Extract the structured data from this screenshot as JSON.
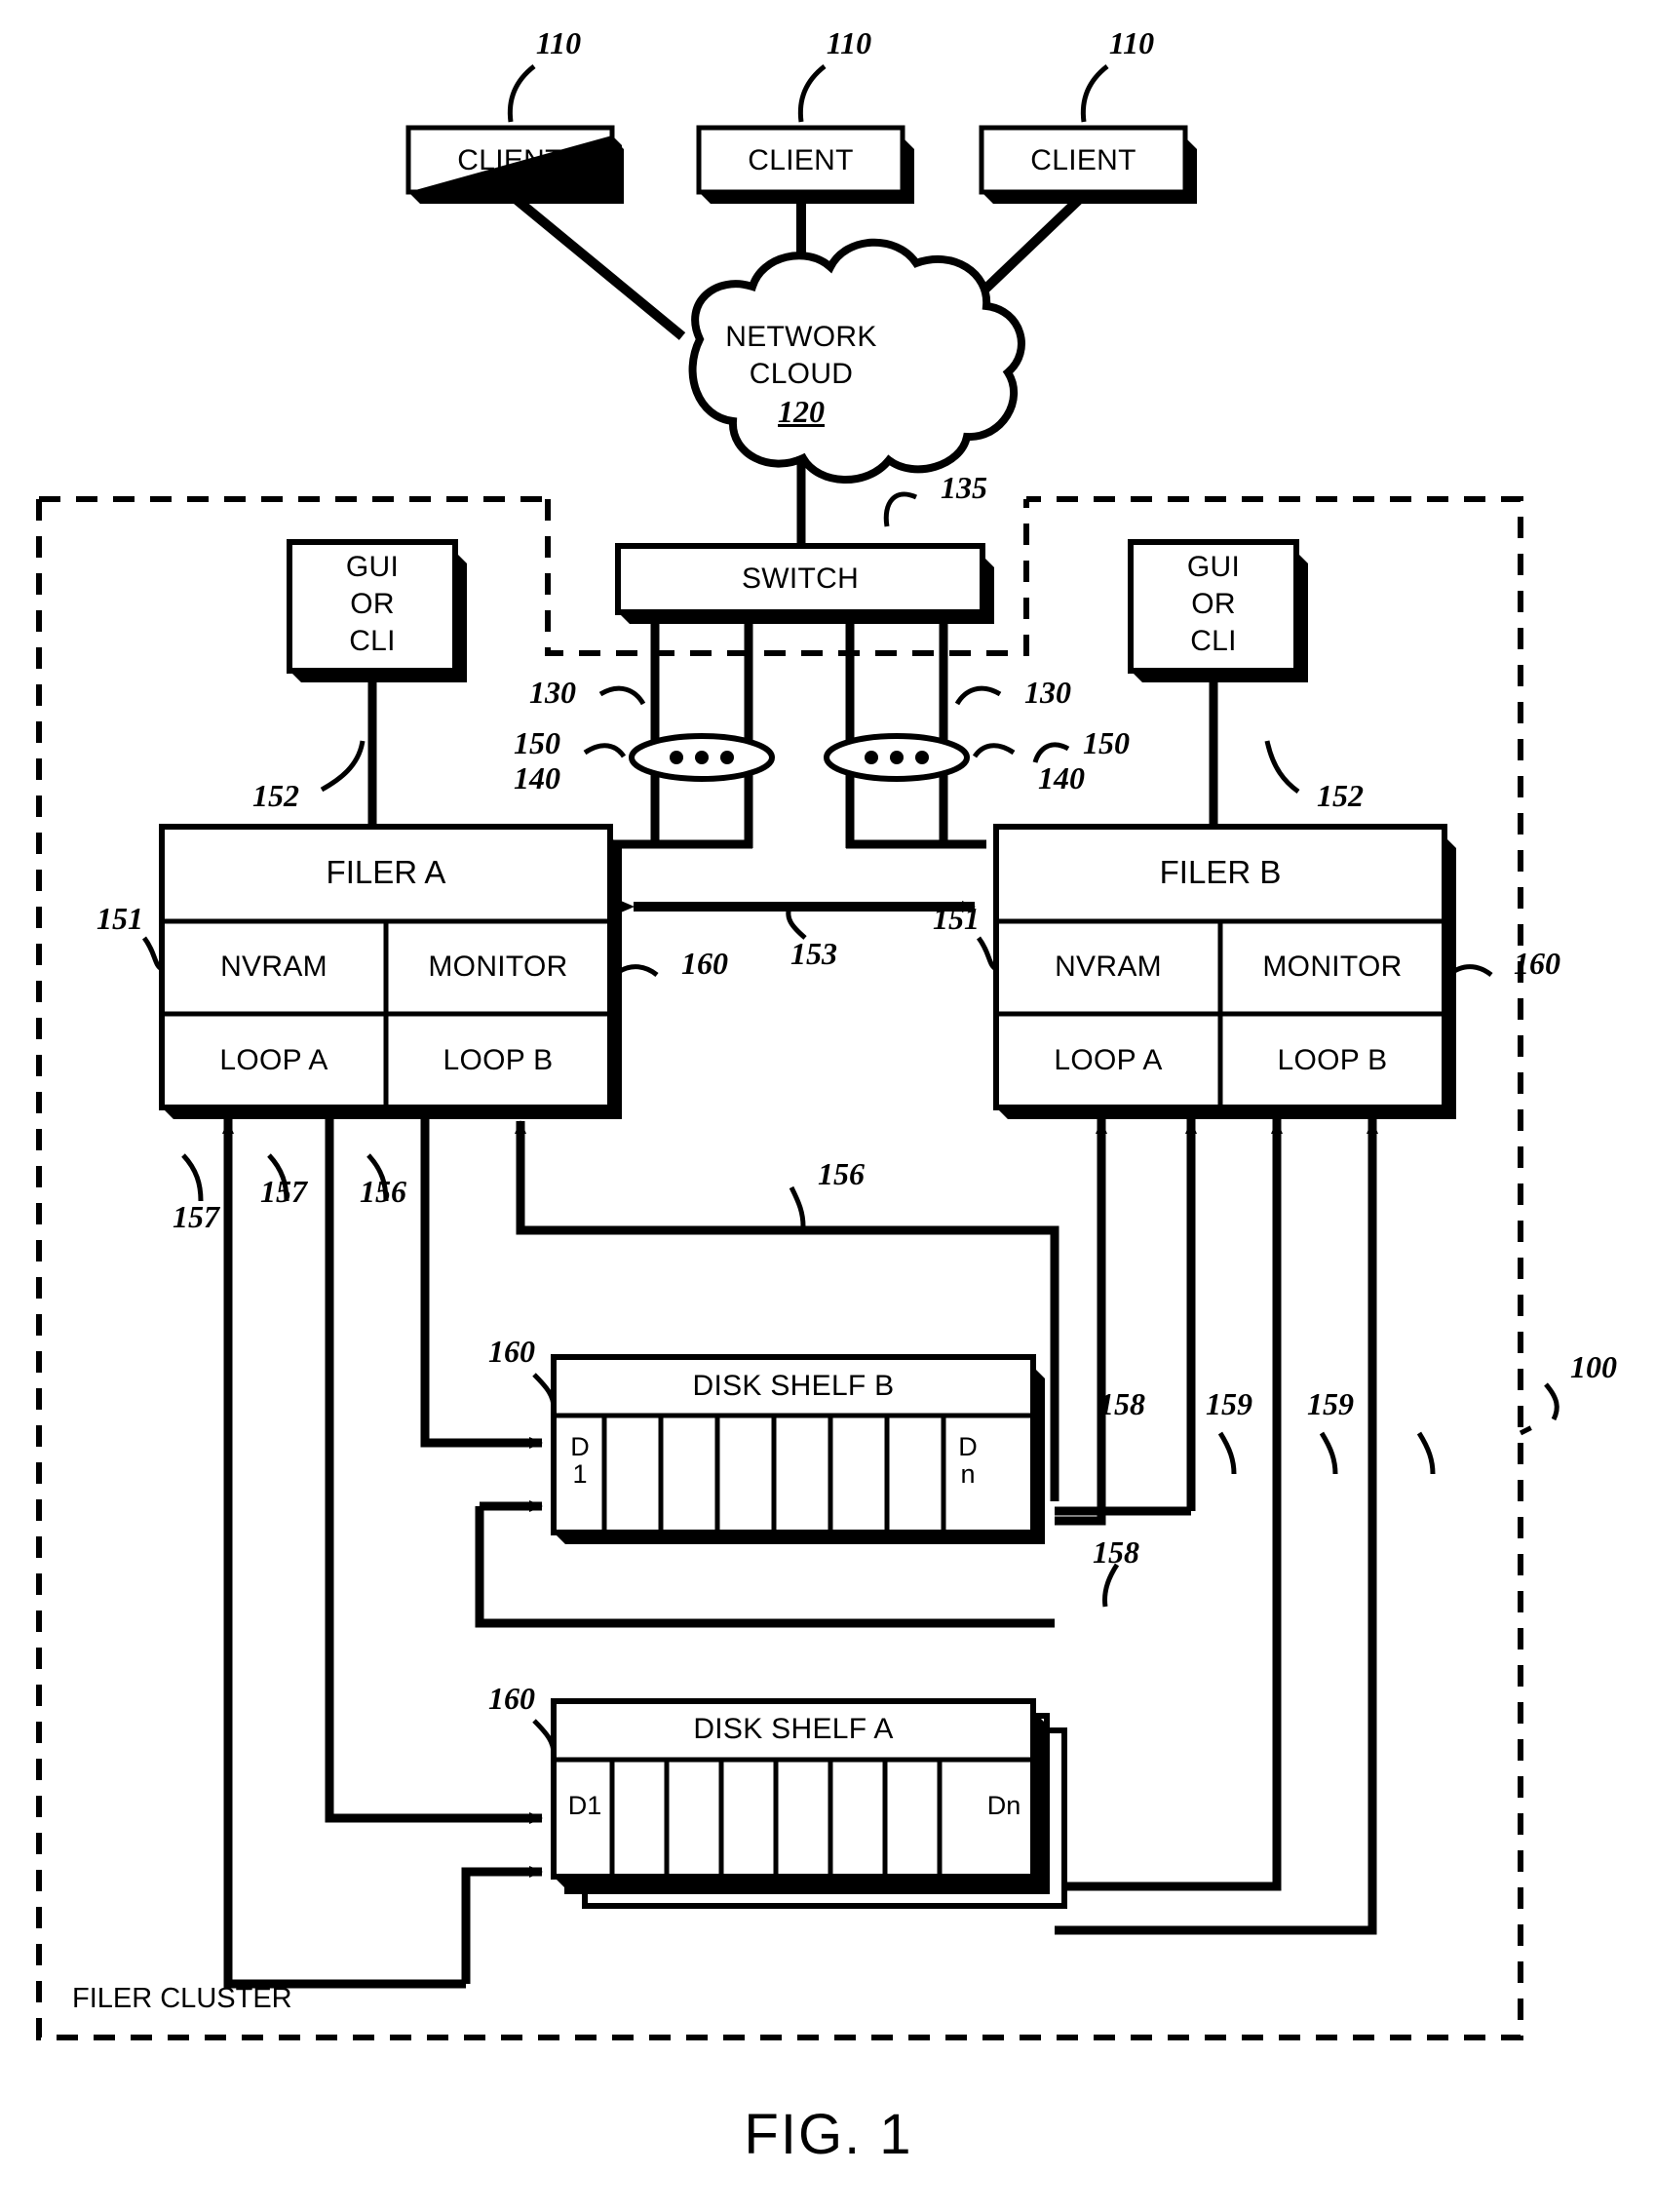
{
  "figure": {
    "caption": "FIG. 1",
    "cluster_label": "FILER CLUSTER",
    "cluster_ref": "100"
  },
  "clients": [
    {
      "label": "CLIENT",
      "ref": "110"
    },
    {
      "label": "CLIENT",
      "ref": "110"
    },
    {
      "label": "CLIENT",
      "ref": "110"
    }
  ],
  "cloud": {
    "line1": "NETWORK",
    "line2": "CLOUD",
    "ref": "120"
  },
  "switch": {
    "label": "SWITCH",
    "ref": "135"
  },
  "consoles": [
    {
      "line1": "GUI",
      "line2": "OR",
      "line3": "CLI",
      "ref": "152"
    },
    {
      "line1": "GUI",
      "line2": "OR",
      "line3": "CLI",
      "ref": "152"
    }
  ],
  "link_refs": {
    "network_adapter_left": "130",
    "network_adapter_right": "130",
    "loop_left_150": "150",
    "loop_left_140": "140",
    "loop_right_150": "150",
    "loop_right_140": "140",
    "interconnect": "153",
    "nvram_left": "151",
    "nvram_right": "151",
    "monitor_left": "160",
    "monitor_right": "160",
    "shelfb_upper": "156",
    "shelfb_lower": "156",
    "loopa_157_left": "157",
    "loopa_157_right": "157",
    "shelfb_158_upper": "158",
    "shelfb_158_lower": "158",
    "shelfa_159_left": "159",
    "shelfa_159_right": "159",
    "shelfb_port": "160",
    "shelfa_port": "160"
  },
  "filers": [
    {
      "title": "FILER A",
      "nvram": "NVRAM",
      "monitor": "MONITOR",
      "loop_a": "LOOP A",
      "loop_b": "LOOP B"
    },
    {
      "title": "FILER B",
      "nvram": "NVRAM",
      "monitor": "MONITOR",
      "loop_a": "LOOP A",
      "loop_b": "LOOP B"
    }
  ],
  "disk_shelves": [
    {
      "title": "DISK SHELF B",
      "first_disk": "D\n1",
      "last_disk": "D\nn",
      "slot_count": 8
    },
    {
      "title": "DISK SHELF A",
      "first_disk": "D1",
      "last_disk": "Dn",
      "slot_count": 8
    }
  ]
}
